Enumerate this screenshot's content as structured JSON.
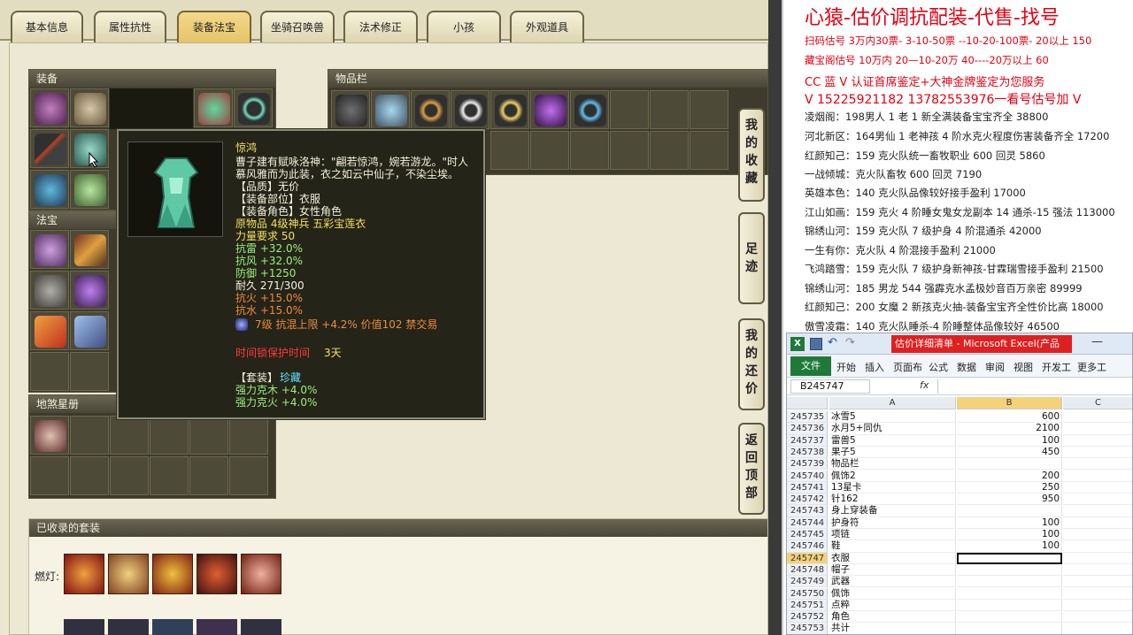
{
  "tabs": [
    {
      "label": "基本信息",
      "active": false
    },
    {
      "label": "属性抗性",
      "active": false
    },
    {
      "label": "装备法宝",
      "active": true
    },
    {
      "label": "坐骑召唤兽",
      "active": false
    },
    {
      "label": "法术修正",
      "active": false
    },
    {
      "label": "小孩",
      "active": false
    },
    {
      "label": "外观道具",
      "active": false
    }
  ],
  "sections": {
    "equipment": "装备",
    "inventory": "物品栏",
    "treasure": "法宝",
    "star_book": "地煞星册",
    "sets": "已收录的套装",
    "set_row_label": "燃灯:"
  },
  "side_buttons": [
    "我的收藏",
    "足迹",
    "我的还价",
    "返回顶部"
  ],
  "tooltip": {
    "name": "惊鸿",
    "desc_1": "曹子建有赋咏洛神：\"翩若惊鸿，婉若游龙。\"时人",
    "desc_2": "慕风雅而为此装，衣之如云中仙子，不染尘埃。",
    "quality": "【品质】无价",
    "part": "【装备部位】衣服",
    "role": "【装备角色】女性角色",
    "origin": "原物品 4级神兵 五彩宝莲衣",
    "strength": "力量要求 50",
    "attr_1": "抗雷 +32.0%",
    "attr_2": "抗风 +32.0%",
    "attr_3": "防御 +1250",
    "durability": "耐久 271/300",
    "attr_4": "抗火 +15.0%",
    "attr_5": "抗水 +15.0%",
    "gem_line": "7级 抗混上限 +4.2% 价值102 禁交易",
    "protect_label": "时间锁保护时间",
    "protect_value": "3天",
    "set_title": "【套装】",
    "set_name": "珍藏",
    "set_attr_1": "强力克木 +4.0%",
    "set_attr_2": "强力克火 +4.0%"
  },
  "right_panel": {
    "title": "心猿-估价调抗配装-代售-找号",
    "lines": [
      {
        "text": "扫码估号 3万内30票- 3-10-50票  --10-20-100票- 20以上 150",
        "red": true
      },
      {
        "text": "藏宝阁估号 10万内 20—10-20万 40----20万以上 60",
        "red": true
      },
      {
        "text": "CC 蓝 V 认证首席鉴定+大神金牌鉴定为您服务",
        "red": true
      },
      {
        "text": "V 15225921182      13782553976一看号估号加 V",
        "red": true
      },
      {
        "text": "凌烟阁：198男人 1 老 1 新全满装备宝宝齐全 38800",
        "red": false
      },
      {
        "text": "河北新区：164男仙 1 老神孩 4 阶水克火程度伤害装备齐全 17200",
        "red": false
      },
      {
        "text": "红颜知己：159 克火队统一畜牧职业 600 回灵 5860",
        "red": false
      },
      {
        "text": "一战倾城：克火队畜牧 600 回灵 7190",
        "red": false
      },
      {
        "text": "英雄本色：140 克火队品像较好接手盈利 17000",
        "red": false
      },
      {
        "text": "江山如画：159 克火 4 阶睡女鬼女龙副本 14 通杀-15 强法 113000",
        "red": false
      },
      {
        "text": "锦绣山河：159 克火队 7 级护身 4 阶混通杀 42000",
        "red": false
      },
      {
        "text": "一生有你：克火队 4 阶混接手盈利 21000",
        "red": false
      },
      {
        "text": "飞鸿踏雪：159 克火队 7 级护身新神孩-甘霖瑞雪接手盈利 21500",
        "red": false
      },
      {
        "text": "锦绣山河：185 男龙 544 强霹克水孟极妙音百万亲密 89999",
        "red": false
      },
      {
        "text": "红颜知己：200 女魔 2 新孩克火抽-装备宝宝齐全性价比高 18000",
        "red": false
      },
      {
        "text": "傲雪凌霜：140 克火队睡杀-4 阶睡整体品像较好 46500",
        "red": false
      }
    ]
  },
  "excel": {
    "title": "估价详细清单 - Microsoft Excel(产品",
    "menu": [
      "开始",
      "插入",
      "页面布",
      "公式",
      "数据",
      "审阅",
      "视图",
      "开发工",
      "更多工"
    ],
    "file_label": "文件",
    "name_box": "B245747",
    "fx": "fx",
    "col_headers": [
      "A",
      "B",
      "C"
    ],
    "rows": [
      {
        "n": "245735",
        "a": "冰雪5",
        "b": "600"
      },
      {
        "n": "245736",
        "a": "水月5+同仇",
        "b": "2100"
      },
      {
        "n": "245737",
        "a": "雷兽5",
        "b": "100"
      },
      {
        "n": "245738",
        "a": "果子5",
        "b": "450"
      },
      {
        "n": "245739",
        "a": "物品栏",
        "b": ""
      },
      {
        "n": "245740",
        "a": "佩饰2",
        "b": "200"
      },
      {
        "n": "245741",
        "a": "13星卡",
        "b": "250"
      },
      {
        "n": "245742",
        "a": "针162",
        "b": "950"
      },
      {
        "n": "245743",
        "a": "身上穿装备",
        "b": ""
      },
      {
        "n": "245744",
        "a": "护身符",
        "b": "100"
      },
      {
        "n": "245745",
        "a": "项链",
        "b": "100"
      },
      {
        "n": "245746",
        "a": "鞋",
        "b": "100"
      },
      {
        "n": "245747",
        "a": "衣服",
        "b": ""
      },
      {
        "n": "245748",
        "a": "帽子",
        "b": ""
      },
      {
        "n": "245749",
        "a": "武器",
        "b": ""
      },
      {
        "n": "245750",
        "a": "佩饰",
        "b": ""
      },
      {
        "n": "245751",
        "a": "点粹",
        "b": ""
      },
      {
        "n": "245752",
        "a": "角色",
        "b": ""
      },
      {
        "n": "245753",
        "a": "共计",
        "b": ""
      }
    ]
  },
  "colors": {
    "tooltip_name": "#f0e060",
    "tooltip_text": "#f4f0dc",
    "tooltip_green": "#9cf07a",
    "tooltip_orange": "#f08a40",
    "tooltip_red": "#ff3a3a",
    "tooltip_cyan": "#60e0ff",
    "accent_red": "#e60012"
  }
}
